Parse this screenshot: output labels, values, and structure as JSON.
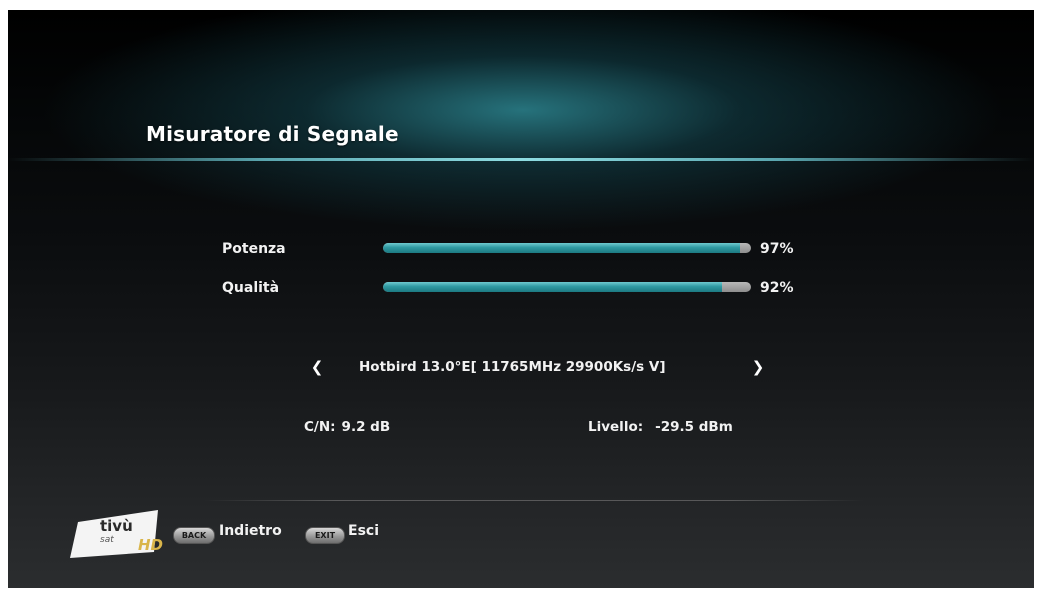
{
  "header": {
    "title": "Misuratore di Segnale"
  },
  "meters": {
    "power": {
      "label": "Potenza",
      "value_text": "97%",
      "level": 0.97
    },
    "quality": {
      "label": "Qualità",
      "value_text": "92%",
      "level": 0.92
    }
  },
  "transponder": {
    "prev_icon": "chevron-left-icon",
    "label": "Hotbird 13.0°E[ 11765MHz 29900Ks/s V]",
    "next_icon": "chevron-right-icon"
  },
  "stats": {
    "cn_label": "C/N:",
    "cn_value": "9.2 dB",
    "level_label": "Livello:",
    "level_value": "-29.5 dBm"
  },
  "footer": {
    "logo": {
      "line1": "tivù",
      "line2": "sat",
      "badge": "HD"
    },
    "back_key": "BACK",
    "back_label": "Indietro",
    "exit_key": "EXIT",
    "exit_label": "Esci"
  },
  "colors": {
    "accent": "#2f9aa2",
    "track": "#8e8e8e",
    "hd_gold": "#d9b54a"
  }
}
